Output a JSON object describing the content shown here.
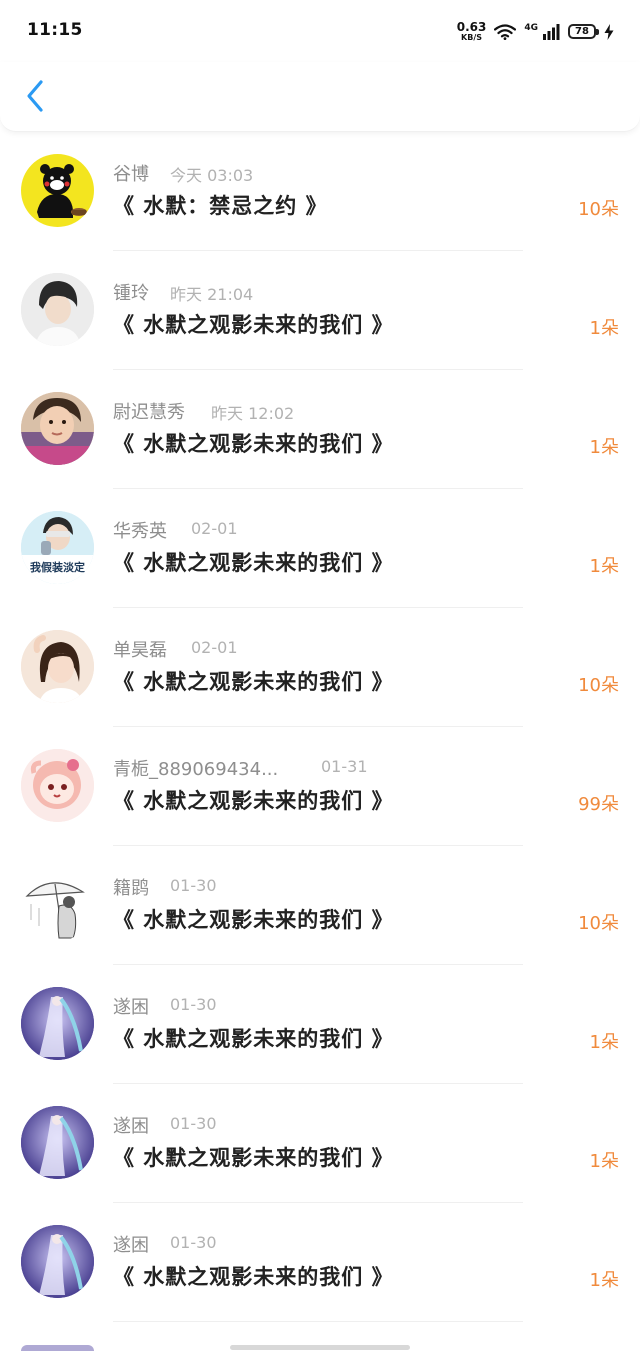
{
  "status_bar": {
    "time": "11:15",
    "net_speed_value": "0.63",
    "net_speed_unit": "KB/S",
    "network": "4G",
    "battery": "78"
  },
  "header": {
    "back_icon": "chevron-left-icon",
    "accent_color": "#2b9af3"
  },
  "colors": {
    "count": "#f08a3c",
    "name": "#8e8e8e",
    "time": "#b2b2b2",
    "title": "#222222"
  },
  "items": [
    {
      "name": "谷博",
      "time": "今天 03:03",
      "title": "《 水默：禁忌之约 》",
      "count": "10朵",
      "avatar": "bear-avatar"
    },
    {
      "name": "锺玲",
      "time": "昨天 21:04",
      "title": "《 水默之观影未来的我们 》",
      "count": "1朵",
      "avatar": "person-avatar"
    },
    {
      "name": "尉迟慧秀",
      "time": "昨天 12:02",
      "title": "《 水默之观影未来的我们 》",
      "count": "1朵",
      "avatar": "child-avatar"
    },
    {
      "name": "华秀英",
      "time": "02-01",
      "title": "《 水默之观影未来的我们 》",
      "count": "1朵",
      "avatar": "text-avatar",
      "avatar_text": "我假装淡定"
    },
    {
      "name": "单昊磊",
      "time": "02-01",
      "title": "《 水默之观影未来的我们 》",
      "count": "10朵",
      "avatar": "girl-avatar"
    },
    {
      "name": "青栀_889069434...",
      "time": "01-31",
      "title": "《 水默之观影未来的我们 》",
      "count": "99朵",
      "avatar": "cartoon-avatar"
    },
    {
      "name": "籍鹍",
      "time": "01-30",
      "title": "《 水默之观影未来的我们 》",
      "count": "10朵",
      "avatar": "umbrella-avatar"
    },
    {
      "name": "遂困",
      "time": "01-30",
      "title": "《 水默之观影未来的我们 》",
      "count": "1朵",
      "avatar": "anime-avatar"
    },
    {
      "name": "遂困",
      "time": "01-30",
      "title": "《 水默之观影未来的我们 》",
      "count": "1朵",
      "avatar": "anime-avatar"
    },
    {
      "name": "遂困",
      "time": "01-30",
      "title": "《 水默之观影未来的我们 》",
      "count": "1朵",
      "avatar": "anime-avatar"
    }
  ]
}
